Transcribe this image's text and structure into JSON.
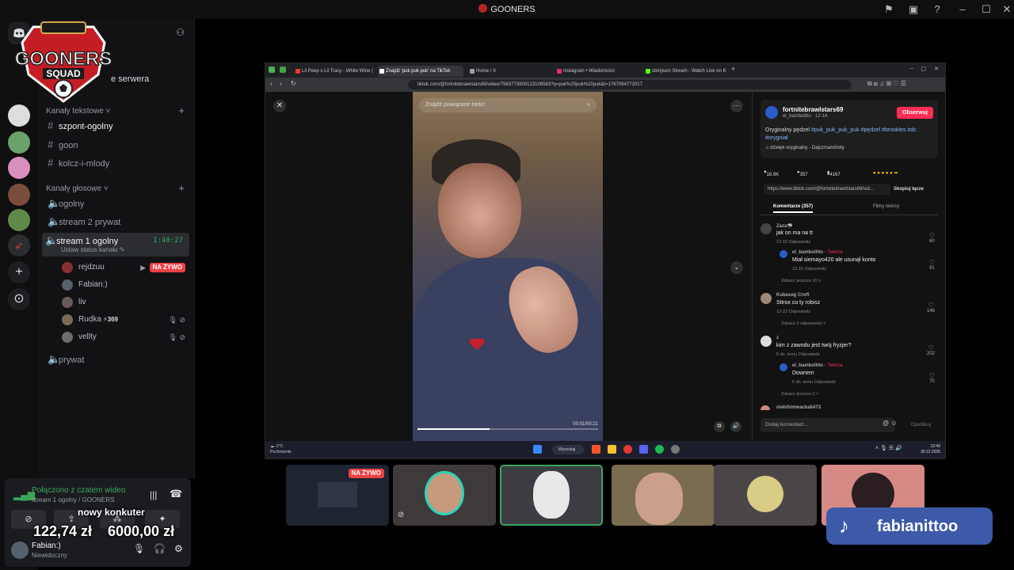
{
  "window": {
    "title": "GOONERS"
  },
  "logo": {
    "line1": "GOONERS",
    "line2": "SQUAD"
  },
  "server_header": {
    "partial_text": "e serwera"
  },
  "sidebar": {
    "text_category": "Kanały tekstowe",
    "text_channels": [
      "szpont-ogolny",
      "goon",
      "kolcz-i-mlody"
    ],
    "voice_category": "Kanały głosowe",
    "voice_channels": [
      "ogolny",
      "stream 2 prywat",
      "stream 1 ogolny",
      "prywat"
    ],
    "active_voice": {
      "name": "stream 1 ogolny",
      "time": "1:40:27",
      "status": "Ustaw status kanału"
    },
    "voice_users": [
      {
        "name": "rejdzuu",
        "badge": "NA ŻYWO"
      },
      {
        "name": "Fabian:)",
        "badge": ""
      },
      {
        "name": "liv",
        "badge": ""
      },
      {
        "name": "Rudka",
        "badge": "369"
      },
      {
        "name": "vellty",
        "badge": ""
      }
    ]
  },
  "voice_panel": {
    "connected": "Połączono z czatem wideo",
    "subtitle": "stream 1 ogolny / GOONERS",
    "user_name": "Fabian:)",
    "user_status": "Niewidoczny"
  },
  "overlay": {
    "label": "nowy konkuter",
    "amount_left": "122,74 zł",
    "amount_right": "6000,00 zł"
  },
  "browser": {
    "tabs": [
      {
        "label": "Lil Peep x Lil Tracy - White Wine (OG)",
        "color": "#e53935"
      },
      {
        "label": "Znajdź 'puk puk puk' na TikTok",
        "color": "#ffffff"
      },
      {
        "label": "Home / X",
        "color": "#9e9e9e"
      },
      {
        "label": "Instagram • Wiadomości",
        "color": "#e1306c"
      },
      {
        "label": "sbmjison Stream - Watch Live on Kick",
        "color": "#53fc18"
      }
    ],
    "url": "tiktok.com/@fortnitebrawlstars69/video/7583775900123106583?q=puk%20puk%20puk&t=1767094772017"
  },
  "tiktok": {
    "search_placeholder": "Znajdź powiązane treści",
    "video_time": "00:01/00:21",
    "username": "fortnitebrawlstars69",
    "subname": "el_bambolitto · 12-14",
    "follow": "Obserwuj",
    "desc_plain": "Oryginalny pędzel",
    "desc_tags": "#puk_puk_puk_puk #pędzel #brookies #dc #orygniał",
    "music": "dźwięk oryginalny - Dajczmanśhoty",
    "likes": "16.9K",
    "comments_count": "357",
    "saves": "4167",
    "link": "https://www.tiktok.com/@fortnitebrawlstars69/vid...",
    "copy": "Skopiuj łącze",
    "tab_comments": "Komentarze (357)",
    "tab_creator": "Filmy twórcy",
    "comments": [
      {
        "user": "Zaza🦈",
        "text": "jak on ma na tt",
        "meta": "12-16    Odpowiedz",
        "likes": "60"
      },
      {
        "user": "el_bambolitto",
        "tag": "Twórca",
        "text": "Miał siemayo420 ale usunął konto",
        "meta": "12-16    Odpowiedz",
        "likes": "91"
      },
      {
        "user": "Kubaxeg Croft",
        "text": "Sitrox co ty robisz",
        "meta": "12-22    Odpowiedz",
        "likes": "146"
      },
      {
        "user": "z",
        "text": "kim z zawodu jest twój fryzjer?",
        "meta": "6 dn. temu    Odpowiedz",
        "likes": "202"
      },
      {
        "user": "el_bambolitto",
        "tag": "Twórca",
        "text": "Downem",
        "meta": "6 dn. temu    Odpowiedz",
        "likes": "70"
      },
      {
        "user": "niebihimwacka6473",
        "text": "",
        "meta": "",
        "likes": ""
      }
    ],
    "see_more_1": "Zobacz jeszcze 10",
    "see_more_2": "Zobacz 2 odpowiedzi",
    "see_more_3": "Zobacz jeszcze 2",
    "add_comment": "Dodaj komentarz...",
    "post": "Opublikuj"
  },
  "taskbar": {
    "weather_temp": "-2°C",
    "weather_desc": "Pochmurnie",
    "search": "Wyszukaj",
    "time": "12:40",
    "date": "30.12.2025"
  },
  "tiles": {
    "live_badge": "NA ŻYWO"
  },
  "tiktok_badge": {
    "name": "fabianittoo"
  }
}
